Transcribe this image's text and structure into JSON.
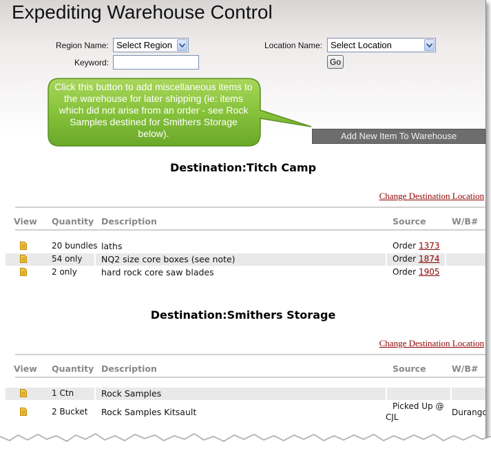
{
  "app": {
    "title": "Expediting Warehouse Control"
  },
  "filters": {
    "region_label": "Region Name:",
    "region_value": "Select Region",
    "location_label": "Location Name:",
    "location_value": "Select Location",
    "keyword_label": "Keyword:",
    "keyword_value": "",
    "go_label": "Go"
  },
  "callout": {
    "text": "Click this button to add miscellaneous items to the warehouse for later shipping (ie: items which did not arise from an order - see Rock Samples destined for Smithers Storage below)."
  },
  "add_button": {
    "label": "Add New Item To Warehouse"
  },
  "columns": {
    "view": "View",
    "quantity": "Quantity",
    "description": "Description",
    "source": "Source",
    "wb": "W/B#"
  },
  "destinations": [
    {
      "title": "Destination:Titch Camp",
      "change_link": "Change Destination Location",
      "rows": [
        {
          "quantity": "20 bundles",
          "description": "laths",
          "source_prefix": "Order",
          "source_link": "1373",
          "wb": ""
        },
        {
          "quantity": "54 only",
          "description": "NQ2 size core boxes (see note)",
          "source_prefix": "Order",
          "source_link": "1874",
          "wb": ""
        },
        {
          "quantity": "2 only",
          "description": "hard rock core saw blades",
          "source_prefix": "Order",
          "source_link": "1905",
          "wb": ""
        }
      ]
    },
    {
      "title": "Destination:Smithers Storage",
      "change_link": "Change Destination Location",
      "rows": [
        {
          "quantity": "1 Ctn",
          "description": "Rock Samples",
          "source_line1": "",
          "source_line2": "",
          "wb": ""
        },
        {
          "quantity": "2 Bucket",
          "description": "Rock Samples Kitsault",
          "source_line1": "Picked Up @",
          "source_line2": "CJL",
          "wb": "Durango"
        }
      ]
    }
  ],
  "colors": {
    "link": "#8b0000",
    "callout_green": "#8dc63f",
    "button_gray": "#6d6d6d",
    "header_gray": "#888888"
  },
  "icons": [
    "document-icon",
    "chevron-down-icon"
  ]
}
